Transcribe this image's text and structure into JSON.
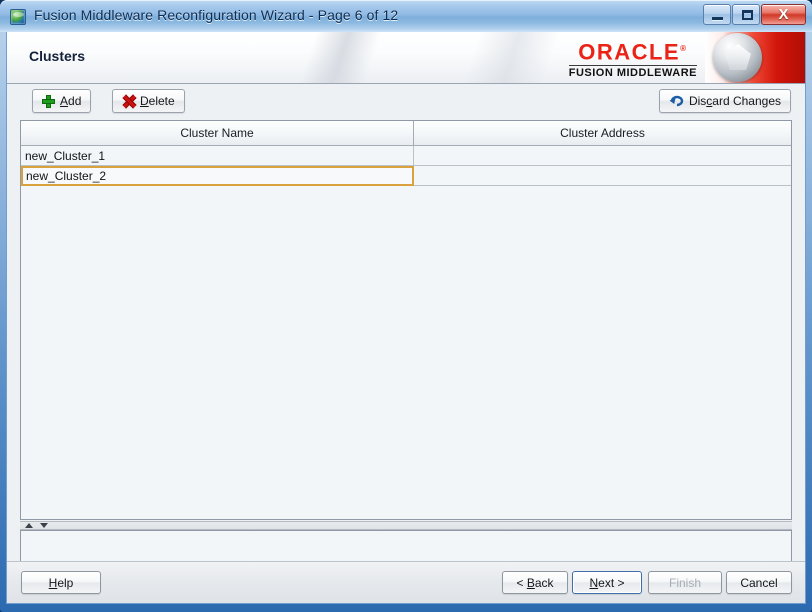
{
  "window": {
    "title": "Fusion Middleware Reconfiguration Wizard - Page 6 of 12",
    "icon": "globe-icon",
    "controls": {
      "minimize": "minimize-icon",
      "maximize": "maximize-icon",
      "close": "X"
    }
  },
  "banner": {
    "page_title": "Clusters",
    "brand": {
      "name": "ORACLE",
      "trademark": "®",
      "subtitle": "FUSION MIDDLEWARE"
    }
  },
  "toolbar": {
    "add": {
      "label_pre": "",
      "mnemonic": "A",
      "label_post": "dd",
      "icon": "plus-icon"
    },
    "delete": {
      "label_pre": "",
      "mnemonic": "D",
      "label_post": "elete",
      "icon": "x-icon"
    },
    "discard": {
      "label_pre": "Dis",
      "mnemonic": "c",
      "label_post": "ard Changes",
      "icon": "undo-icon"
    }
  },
  "table": {
    "columns": [
      "Cluster Name",
      "Cluster Address"
    ],
    "rows": [
      {
        "name": "new_Cluster_1",
        "address": "",
        "editing": false
      },
      {
        "name": "new_Cluster_2",
        "address": "",
        "editing": true
      }
    ]
  },
  "splitter": {
    "collapse_up": "triangle-up-icon",
    "collapse_down": "triangle-down-icon"
  },
  "footer": {
    "help": {
      "label_pre": "",
      "mnemonic": "H",
      "label_post": "elp"
    },
    "back": {
      "label_pre": "< ",
      "mnemonic": "B",
      "label_post": "ack"
    },
    "next": {
      "label_pre": "",
      "mnemonic": "N",
      "label_post": "ext >"
    },
    "finish": {
      "label": "Finish",
      "disabled": true
    },
    "cancel": {
      "label": "Cancel"
    }
  },
  "colors": {
    "brand_red": "#ea2316",
    "selection_border": "#d9a23c",
    "titlebar_blue": "#8fb9e4",
    "focus_blue": "#3f6ea8"
  }
}
